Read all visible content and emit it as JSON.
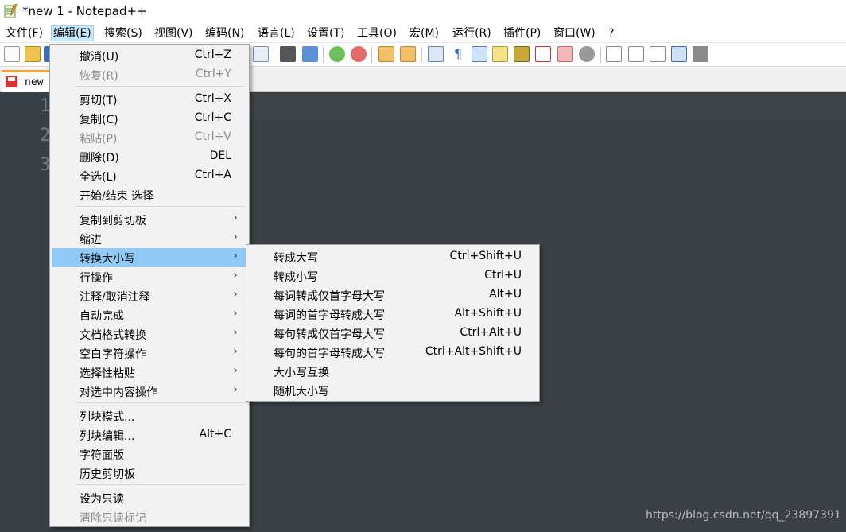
{
  "window": {
    "title": "*new 1 - Notepad++"
  },
  "menubar": [
    {
      "label": "文件(F)"
    },
    {
      "label": "编辑(E)"
    },
    {
      "label": "搜索(S)"
    },
    {
      "label": "视图(V)"
    },
    {
      "label": "编码(N)"
    },
    {
      "label": "语言(L)"
    },
    {
      "label": "设置(T)"
    },
    {
      "label": "工具(O)"
    },
    {
      "label": "宏(M)"
    },
    {
      "label": "运行(R)"
    },
    {
      "label": "插件(P)"
    },
    {
      "label": "窗口(W)"
    },
    {
      "label": "?"
    }
  ],
  "tab": {
    "label": "new"
  },
  "editor": {
    "line_numbers": [
      "1",
      "2",
      "3"
    ]
  },
  "edit_menu": {
    "undo": {
      "label": "撤消(U)",
      "shortcut": "Ctrl+Z"
    },
    "redo": {
      "label": "恢复(R)",
      "shortcut": "Ctrl+Y"
    },
    "cut": {
      "label": "剪切(T)",
      "shortcut": "Ctrl+X"
    },
    "copy": {
      "label": "复制(C)",
      "shortcut": "Ctrl+C"
    },
    "paste": {
      "label": "粘贴(P)",
      "shortcut": "Ctrl+V"
    },
    "delete": {
      "label": "删除(D)",
      "shortcut": "DEL"
    },
    "select_all": {
      "label": "全选(L)",
      "shortcut": "Ctrl+A"
    },
    "begin_end_select": {
      "label": "开始/结束 选择"
    },
    "copy_to_clipboard": {
      "label": "复制到剪切板"
    },
    "indent": {
      "label": "缩进"
    },
    "convert_case": {
      "label": "转换大小写"
    },
    "line_ops": {
      "label": "行操作"
    },
    "comment": {
      "label": "注释/取消注释"
    },
    "auto_complete": {
      "label": "自动完成"
    },
    "eol_conversion": {
      "label": "文档格式转换"
    },
    "blank_ops": {
      "label": "空白字符操作"
    },
    "paste_special": {
      "label": "选择性粘贴"
    },
    "on_selection": {
      "label": "对选中内容操作"
    },
    "column_mode": {
      "label": "列块模式..."
    },
    "column_editor": {
      "label": "列块编辑...",
      "shortcut": "Alt+C"
    },
    "char_panel": {
      "label": "字符面版"
    },
    "clipboard_history": {
      "label": "历史剪切板"
    },
    "set_readonly": {
      "label": "设为只读"
    },
    "clear_readonly": {
      "label": "清除只读标记"
    },
    "arrow": "›"
  },
  "case_menu": {
    "upper": {
      "label": "转成大写",
      "shortcut": "Ctrl+Shift+U"
    },
    "lower": {
      "label": "转成小写",
      "shortcut": "Ctrl+U"
    },
    "proper_force": {
      "label": "每词转成仅首字母大写",
      "shortcut": "Alt+U"
    },
    "proper_blend": {
      "label": "每词的首字母转成大写",
      "shortcut": "Alt+Shift+U"
    },
    "sentence_force": {
      "label": "每句转成仅首字母大写",
      "shortcut": "Ctrl+Alt+U"
    },
    "sentence_blend": {
      "label": "每句的首字母转成大写",
      "shortcut": "Ctrl+Alt+Shift+U"
    },
    "invert": {
      "label": "大小写互换"
    },
    "random": {
      "label": "随机大小写"
    }
  },
  "watermark": "https://blog.csdn.net/qq_23897391",
  "colors": {
    "menu_highlight": "#91c9f7",
    "editor_bg": "#3a4044",
    "tab_accent": "#f2a23a"
  }
}
